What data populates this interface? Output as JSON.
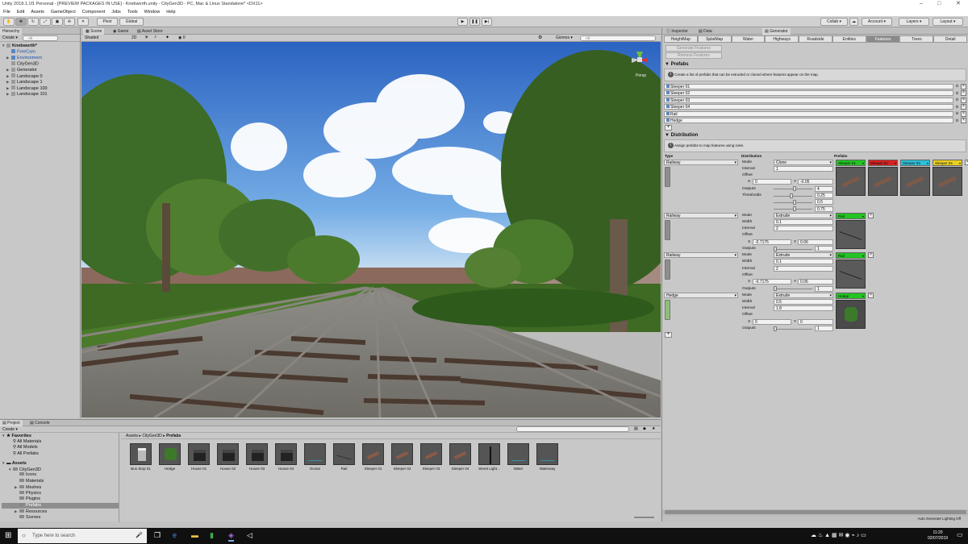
{
  "window": {
    "title": "Unity 2018.1.1f1 Personal - [PREVIEW PACKAGES IN USE] - Knebworth.unity - CityGen3D - PC, Mac & Linux Standalone* <DX11>"
  },
  "menu": [
    "File",
    "Edit",
    "Assets",
    "GameObject",
    "Component",
    "Jobs",
    "Tools",
    "Window",
    "Help"
  ],
  "toolbar": {
    "pivot": "Pivot",
    "global": "Global",
    "collab": "Collab ▾",
    "account": "Account ▾",
    "layers": "Layers ▾",
    "layout": "Layout ▾"
  },
  "hierarchy": {
    "tab": "Hierarchy",
    "create": "Create ▾",
    "search_placeholder": "All",
    "scene": "Knebworth*",
    "items": [
      {
        "label": "FreeCam",
        "blue": true
      },
      {
        "label": "Environment",
        "blue": true
      },
      {
        "label": "CityGen3D",
        "blue": false
      },
      {
        "label": "Generator",
        "blue": false
      },
      {
        "label": "Landscape 0",
        "blue": false
      },
      {
        "label": "Landscape 1",
        "blue": false
      },
      {
        "label": "Landscape 100",
        "blue": false
      },
      {
        "label": "Landscape 101",
        "blue": false
      }
    ]
  },
  "scene_view": {
    "tabs": [
      "Scene",
      "Game",
      "Asset Store"
    ],
    "shading": "Shaded",
    "mode_2d": "2D",
    "gizmos": "Gizmos ▾",
    "search_placeholder": "All",
    "gizmo_label": "Persp",
    "counter": "0"
  },
  "inspector": {
    "tabs": [
      "Inspector",
      "Data",
      "Generator"
    ],
    "generator_tabs": [
      "HeightMap",
      "SplatMap",
      "Water",
      "Highways",
      "Roadside",
      "Entities",
      "Features",
      "Trees",
      "Detail"
    ],
    "active_tab": "Features",
    "generate_btn": "Generate Features",
    "remove_btn": "Remove Features",
    "prefabs_header": "Prefabs",
    "prefabs_info": "Create a list of prefabs that can be extruded or cloned where features appear on the map.",
    "prefabs": [
      "Sleeper 01",
      "Sleeper 02",
      "Sleeper 03",
      "Sleeper 04",
      "Rail",
      "Hedge"
    ],
    "add": "+",
    "distribution_header": "Distribution",
    "distribution_info": "Assign prefabs to map features using rules.",
    "col_type": "Type",
    "col_distribution": "Distribution",
    "col_prefabs": "Prefabs",
    "rules": [
      {
        "type": "Railway",
        "mode_label": "Mode",
        "mode": "Clone",
        "fields": [
          {
            "label": "Interval",
            "value": "1"
          }
        ],
        "offset_label": "Offset",
        "offset_x": "0",
        "offset_y": "-0.05",
        "outputs_label": "Outputs",
        "outputs": "4",
        "outputs_fill": 0.55,
        "thresholds_label": "Thresholds",
        "thresholds": [
          "0.25",
          "0.5",
          "0.75"
        ],
        "thresholds_fill": [
          0.45,
          0.55,
          0.55
        ],
        "prefabs": [
          {
            "label": "Sleeper 01",
            "color": "#22c422"
          },
          {
            "label": "Sleeper 02",
            "color": "#d62020"
          },
          {
            "label": "Sleeper 03",
            "color": "#2cbfd6"
          },
          {
            "label": "Sleeper 04",
            "color": "#e8d020"
          }
        ]
      },
      {
        "type": "Railway",
        "mode_label": "Mode",
        "mode": "Extrude",
        "fields": [
          {
            "label": "Width",
            "value": "0.1"
          },
          {
            "label": "Interval",
            "value": "2"
          }
        ],
        "offset_label": "Offset",
        "offset_x": "-0.7175",
        "offset_y": "0.06",
        "outputs_label": "Outputs",
        "outputs": "1",
        "outputs_fill": 0.05,
        "prefabs": [
          {
            "label": "Rail",
            "color": "#22c422"
          }
        ]
      },
      {
        "type": "Railway",
        "mode_label": "Mode",
        "mode": "Extrude",
        "fields": [
          {
            "label": "Width",
            "value": "0.1"
          },
          {
            "label": "Interval",
            "value": "2"
          }
        ],
        "offset_label": "Offset",
        "offset_x": "-0.7175",
        "offset_y": "0.06",
        "outputs_label": "Outputs",
        "outputs": "1",
        "outputs_fill": 0.05,
        "prefabs": [
          {
            "label": "Rail",
            "color": "#22c422"
          }
        ]
      },
      {
        "type": "Hedge",
        "mode_label": "Mode",
        "mode": "Extrude",
        "fields": [
          {
            "label": "Width",
            "value": "0.5"
          },
          {
            "label": "Interval",
            "value": "1.8"
          }
        ],
        "offset_label": "Offset",
        "offset_x": "0",
        "offset_y": "0",
        "outputs_label": "Outputs",
        "outputs": "1",
        "outputs_fill": 0.05,
        "prefabs": [
          {
            "label": "Hedge",
            "color": "#22c422"
          }
        ]
      }
    ],
    "status": "Auto Generate Lighting Off"
  },
  "project": {
    "tabs": [
      "Project",
      "Console"
    ],
    "create": "Create ▾",
    "breadcrumb": [
      "Assets",
      "CityGen3D",
      "Prefabs"
    ],
    "favorites": "Favorites",
    "fav_items": [
      "All Materials",
      "All Models",
      "All Prefabs"
    ],
    "assets": "Assets",
    "tree": [
      {
        "label": "CityGen3D",
        "d": 1
      },
      {
        "label": "Icons",
        "d": 2
      },
      {
        "label": "Materials",
        "d": 2
      },
      {
        "label": "Meshes",
        "d": 2
      },
      {
        "label": "Physics",
        "d": 2
      },
      {
        "label": "Plugins",
        "d": 2
      },
      {
        "label": "Prefabs",
        "d": 2
      },
      {
        "label": "Resources",
        "d": 2
      },
      {
        "label": "Scenes",
        "d": 2
      }
    ],
    "items": [
      {
        "label": "Bus Stop 01",
        "icon": "bus-stop-icon"
      },
      {
        "label": "Hedge",
        "icon": "hedge-icon"
      },
      {
        "label": "House 01",
        "icon": "house-icon"
      },
      {
        "label": "House 02",
        "icon": "house-icon"
      },
      {
        "label": "House 03",
        "icon": "house-icon"
      },
      {
        "label": "House 04",
        "icon": "house-icon"
      },
      {
        "label": "Ocean",
        "icon": "water-icon"
      },
      {
        "label": "Rail",
        "icon": "rail-icon"
      },
      {
        "label": "Sleeper 01",
        "icon": "sleeper-icon"
      },
      {
        "label": "Sleeper 02",
        "icon": "sleeper-icon"
      },
      {
        "label": "Sleeper 03",
        "icon": "sleeper-icon"
      },
      {
        "label": "Sleeper 04",
        "icon": "sleeper-icon"
      },
      {
        "label": "Street Light...",
        "icon": "street-light-icon"
      },
      {
        "label": "Water",
        "icon": "water-icon"
      },
      {
        "label": "Waterway",
        "icon": "water-icon"
      }
    ]
  },
  "taskbar": {
    "search_placeholder": "Type here to search",
    "time": "11:20",
    "date": "02/07/2019"
  }
}
